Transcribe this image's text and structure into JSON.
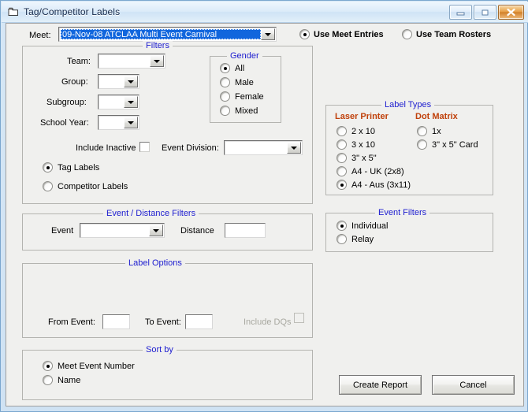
{
  "window": {
    "title": "Tag/Competitor Labels",
    "icon": "labels-window-icon",
    "buttons": {
      "minimize": "minimize-icon",
      "maximize": "maximize-icon",
      "close": "close-icon"
    }
  },
  "meet": {
    "label": "Meet:",
    "value": "09-Nov-08 ATCLAA Multi Event Carnival",
    "placeholder": ""
  },
  "source": {
    "options": [
      {
        "label": "Use Meet Entries",
        "selected": true
      },
      {
        "label": "Use Team Rosters",
        "selected": false
      }
    ]
  },
  "filters": {
    "title": "Filters",
    "team": {
      "label": "Team:",
      "value": ""
    },
    "group": {
      "label": "Group:",
      "value": ""
    },
    "subgroup": {
      "label": "Subgroup:",
      "value": ""
    },
    "school_year": {
      "label": "School Year:",
      "value": ""
    },
    "include_inactive": {
      "label": "Include Inactive",
      "checked": false
    },
    "event_division": {
      "label": "Event Division:",
      "value": ""
    },
    "gender": {
      "title": "Gender",
      "options": [
        {
          "label": "All",
          "selected": true
        },
        {
          "label": "Male",
          "selected": false
        },
        {
          "label": "Female",
          "selected": false
        },
        {
          "label": "Mixed",
          "selected": false
        }
      ]
    },
    "label_mode": [
      {
        "label": "Tag Labels",
        "selected": true
      },
      {
        "label": "Competitor Labels",
        "selected": false
      }
    ]
  },
  "event_distance": {
    "title": "Event / Distance Filters",
    "event": {
      "label": "Event",
      "value": ""
    },
    "distance": {
      "label": "Distance",
      "value": ""
    }
  },
  "label_options": {
    "title": "Label Options",
    "from_event": {
      "label": "From Event:",
      "value": ""
    },
    "to_event": {
      "label": "To Event:",
      "value": ""
    },
    "include_dqs": {
      "label": "Include DQs",
      "checked": false,
      "disabled": true
    }
  },
  "sort_by": {
    "title": "Sort by",
    "options": [
      {
        "label": "Meet Event Number",
        "selected": true
      },
      {
        "label": "Name",
        "selected": false
      }
    ]
  },
  "label_types": {
    "title": "Label Types",
    "laser_heading": "Laser Printer",
    "dot_heading": "Dot Matrix",
    "laser": [
      {
        "label": "2 x 10",
        "selected": false
      },
      {
        "label": "3 x 10",
        "selected": false
      },
      {
        "label": "3\" x 5\"",
        "selected": false
      },
      {
        "label": "A4 - UK    (2x8)",
        "selected": false
      },
      {
        "label": "A4 - Aus  (3x11)",
        "selected": true
      }
    ],
    "dot_matrix": [
      {
        "label": "1x",
        "selected": false
      },
      {
        "label": "3\" x 5\" Card",
        "selected": false
      }
    ]
  },
  "event_filters": {
    "title": "Event Filters",
    "options": [
      {
        "label": "Individual",
        "selected": true
      },
      {
        "label": "Relay",
        "selected": false
      }
    ]
  },
  "actions": {
    "create_report": "Create Report",
    "cancel": "Cancel"
  },
  "colors": {
    "group_title": "#2020d0",
    "heading_orange": "#c0410b",
    "selection_blue": "#1166dd",
    "face": "#f0f0ee"
  }
}
